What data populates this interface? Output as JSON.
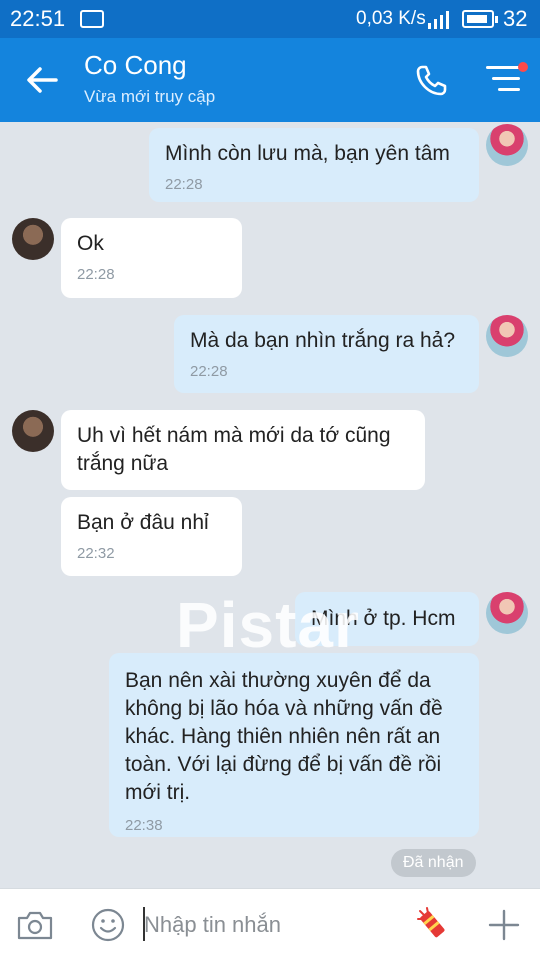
{
  "status_bar": {
    "time": "22:51",
    "speed": "0,03 K/s",
    "battery": "32"
  },
  "header": {
    "contact_name": "Co Cong",
    "status": "Vừa mới truy cập"
  },
  "messages": [
    {
      "side": "out",
      "text": "Mình còn lưu mà, bạn yên tâm",
      "time": "22:28"
    },
    {
      "side": "in",
      "text": "Ok",
      "time": "22:28"
    },
    {
      "side": "out",
      "text": "Mà da bạn nhìn trắng ra hả?",
      "time": "22:28"
    },
    {
      "side": "in",
      "text": "Uh vì hết nám mà mới da tớ cũng trắng nữa",
      "time": ""
    },
    {
      "side": "in",
      "text": "Bạn ở đâu nhỉ",
      "time": "22:32"
    },
    {
      "side": "out",
      "text": "Mình ở tp. Hcm",
      "time": ""
    },
    {
      "side": "out",
      "text": "Bạn nên xài thường xuyên để da không bị lão hóa và những vấn đề khác. Hàng thiên nhiên nên rất an toàn. Với lại đừng để bị vấn đề rồi mới trị.",
      "time": "22:38"
    }
  ],
  "watermark": "Pistar",
  "seen_label": "Đã nhận",
  "input": {
    "placeholder": "Nhập tin nhắn"
  },
  "colors": {
    "status_bar": "#0f6fc6",
    "header": "#1484dd",
    "chat_background": "#dfe4ea",
    "incoming_bubble": "#ffffff",
    "outgoing_bubble": "#d8ecfb"
  },
  "icons": [
    "back-arrow-icon",
    "phone-icon",
    "menu-icon",
    "camera-icon",
    "emoji-icon",
    "sticker-icon",
    "plus-icon"
  ]
}
